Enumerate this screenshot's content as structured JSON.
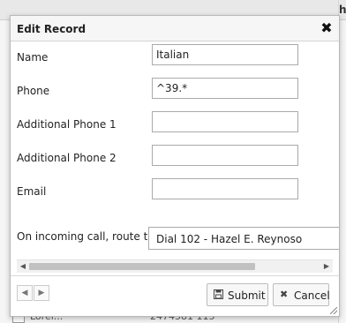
{
  "background": {
    "header_fragment": "h",
    "row_fragment_1": "Lorel...",
    "row_fragment_2": "2474581 115"
  },
  "dialog": {
    "title": "Edit Record",
    "close_glyph": "✖",
    "fields": [
      {
        "label": "Name",
        "value": ""
      },
      {
        "label": "Phone",
        "value": ""
      },
      {
        "label": "Additional Phone 1",
        "value": ""
      },
      {
        "label": "Additional Phone 2",
        "value": ""
      },
      {
        "label": "Email",
        "value": ""
      }
    ],
    "route": {
      "label": "On incoming call, route to",
      "selected": "Dial 102 - Hazel E. Reynoso"
    },
    "name_value": "Italian",
    "phone_value": "^39.*",
    "footer": {
      "prev_glyph": "◀",
      "next_glyph": "▶",
      "submit_label": "Submit",
      "cancel_label": "Cancel",
      "submit_icon": "save-icon",
      "cancel_icon": "close-icon"
    }
  }
}
